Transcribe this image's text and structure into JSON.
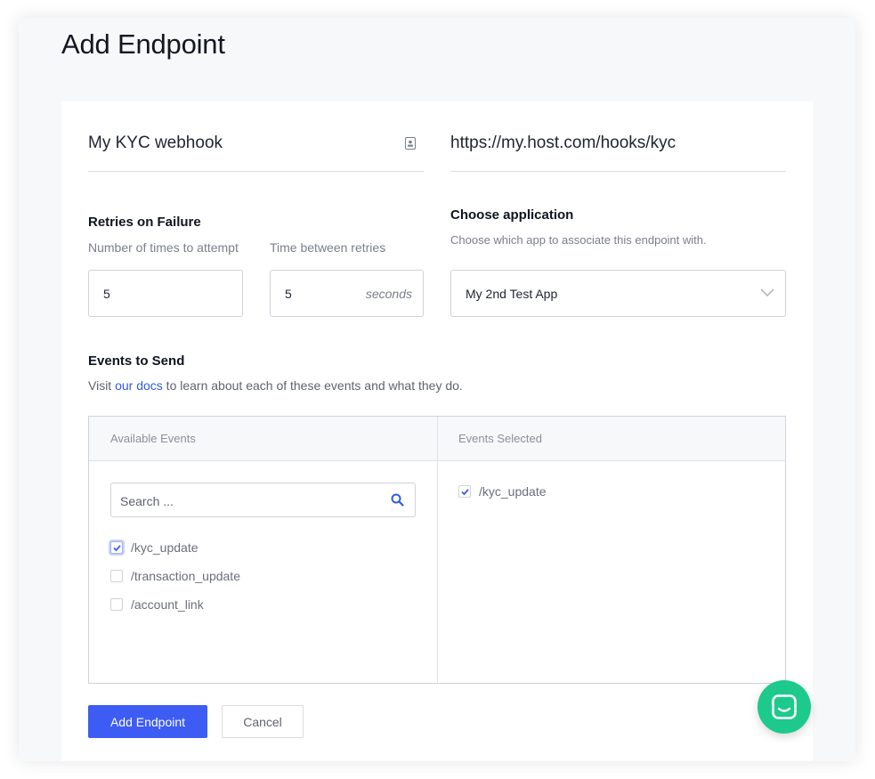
{
  "title": "Add Endpoint",
  "endpoint": {
    "name_value": "My KYC webhook",
    "url_value": "https://my.host.com/hooks/kyc"
  },
  "retries": {
    "heading": "Retries on Failure",
    "attempts_label": "Number of times to attempt",
    "attempts_value": "5",
    "interval_label": "Time between retries",
    "interval_value": "5",
    "interval_unit": "seconds"
  },
  "application": {
    "heading": "Choose application",
    "hint": "Choose which app to associate this endpoint with.",
    "selected": "My 2nd Test App"
  },
  "events": {
    "heading": "Events to Send",
    "intro_before": "Visit ",
    "docs_link": "our docs",
    "intro_after": " to learn about each of these events and what they do.",
    "available_header": "Available Events",
    "selected_header": "Events Selected",
    "search_placeholder": "Search ...",
    "available": [
      {
        "label": "/kyc_update",
        "checked": true
      },
      {
        "label": "/transaction_update",
        "checked": false
      },
      {
        "label": "/account_link",
        "checked": false
      }
    ],
    "selected": [
      {
        "label": "/kyc_update",
        "checked": true
      }
    ]
  },
  "actions": {
    "submit_label": "Add Endpoint",
    "cancel_label": "Cancel"
  },
  "colors": {
    "primary": "#3d5cf4",
    "link": "#2d5be3",
    "chat": "#1ec98e"
  },
  "icons": [
    "contact-card-icon",
    "chevron-down-icon",
    "search-icon",
    "checkmark-icon",
    "chat-icon"
  ]
}
